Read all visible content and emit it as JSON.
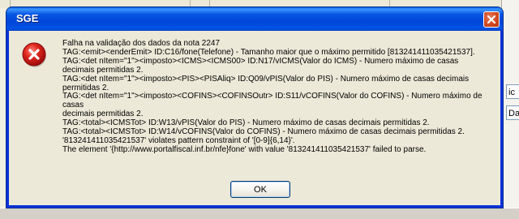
{
  "background": {
    "right_fields": [
      "ic",
      "Dac"
    ]
  },
  "dialog": {
    "title": "SGE",
    "icon": "error-icon",
    "close_icon": "close-icon",
    "message_lines": [
      "Falha na validação dos dados da nota 2247",
      "TAG:<emit><enderEmit> ID:C16/fone(Telefone) - Tamanho maior que o máximo permitido [813241411035421537].",
      "TAG:<det nItem=\"1\"><imposto><ICMS><ICMS00> ID:N17/vICMS(Valor do ICMS) - Numero máximo de casas",
      "decimais permitidas 2.",
      "TAG:<det nItem=\"1\"><imposto><PIS><PISAliq> ID:Q09/vPIS(Valor do PIS) - Numero máximo de casas decimais",
      "permitidas 2.",
      "TAG:<det nItem=\"1\"><imposto><COFINS><COFINSOutr> ID:S11/vCOFINS(Valor do COFINS) - Numero máximo de casas",
      "decimais permitidas 2.",
      "TAG:<total><ICMSTot> ID:W13/vPIS(Valor do PIS) - Numero máximo de casas decimais permitidas 2.",
      "TAG:<total><ICMSTot> ID:W14/vCOFINS(Valor do COFINS) - Numero máximo de casas decimais permitidas 2.",
      "'813241411035421537' violates pattern constraint of '[0-9]{6,14}'.",
      "The element '{http://www.portalfiscal.inf.br/nfe}fone' with value '813241411035421537' failed to parse."
    ],
    "ok_label": "OK"
  },
  "colors": {
    "titlebar": "#0052e6",
    "close_button": "#d34a21",
    "client": "#ece9d8",
    "error_red": "#d21818"
  }
}
